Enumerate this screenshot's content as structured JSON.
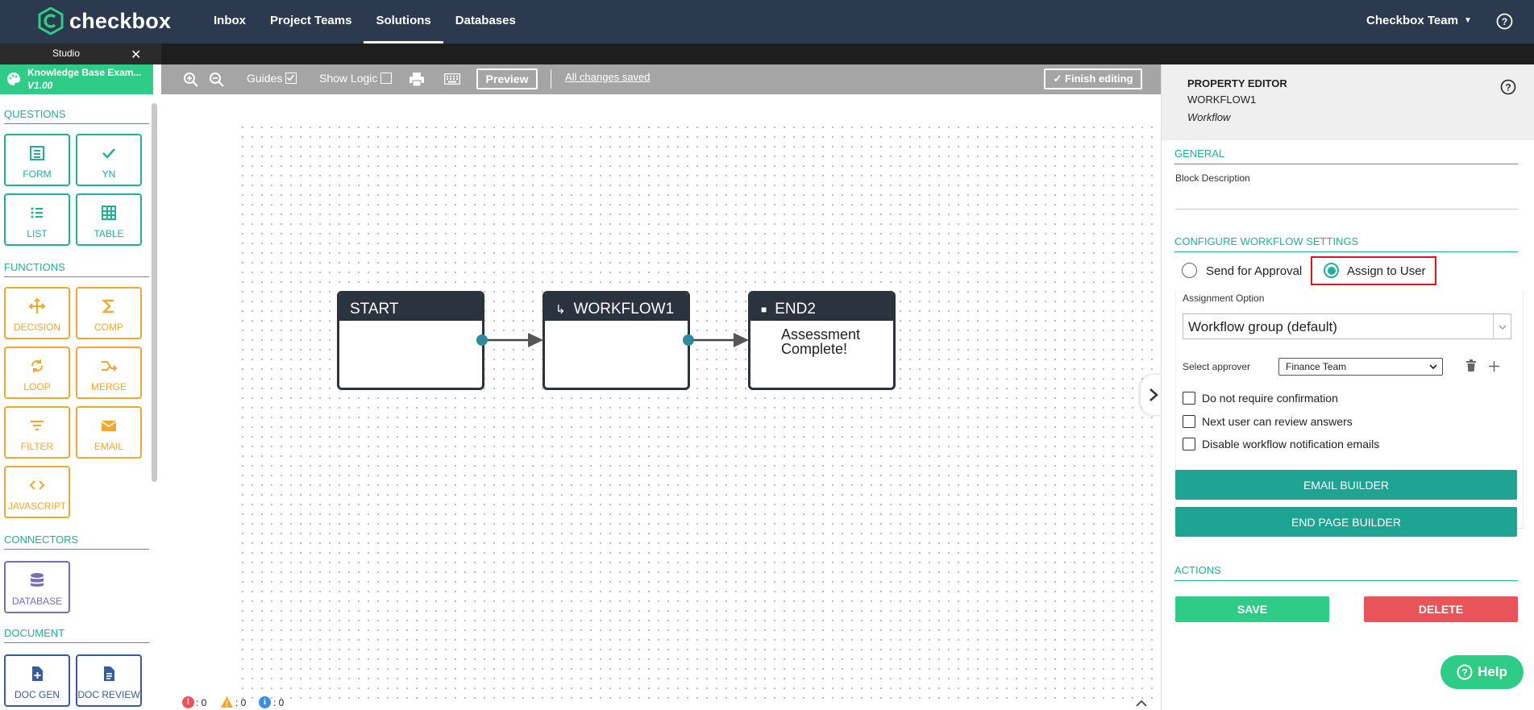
{
  "brand": {
    "name": "checkbox",
    "color": "#2ecc87"
  },
  "nav": {
    "links": [
      {
        "label": "Inbox",
        "active": false
      },
      {
        "label": "Project Teams",
        "active": false
      },
      {
        "label": "Solutions",
        "active": true
      },
      {
        "label": "Databases",
        "active": false
      }
    ],
    "team": "Checkbox Team"
  },
  "studio": {
    "tab_label": "Studio",
    "close": "✕"
  },
  "project": {
    "title": "Knowledge Base Exam...",
    "version": "V1.00"
  },
  "sidebar": {
    "questions": {
      "title": "QUESTIONS",
      "items": [
        "FORM",
        "YN",
        "LIST",
        "TABLE"
      ]
    },
    "functions": {
      "title": "FUNCTIONS",
      "items": [
        "DECISION",
        "COMP",
        "LOOP",
        "MERGE",
        "FILTER",
        "EMAIL",
        "JAVASCRIPT"
      ]
    },
    "connectors": {
      "title": "CONNECTORS",
      "items": [
        "DATABASE"
      ]
    },
    "document": {
      "title": "DOCUMENT",
      "items": [
        "DOC GEN",
        "DOC REVIEW"
      ]
    }
  },
  "toolbar": {
    "guides": "Guides",
    "guides_checked": true,
    "show_logic": "Show Logic",
    "show_logic_checked": false,
    "preview": "Preview",
    "status": "All changes saved",
    "finish": "Finish editing"
  },
  "canvas": {
    "nodes": [
      {
        "title": "START",
        "icon": "",
        "body": ""
      },
      {
        "title": "WORKFLOW1",
        "icon": "↳",
        "body": ""
      },
      {
        "title": "END2",
        "icon": "■",
        "body": "Assessment Complete!"
      }
    ]
  },
  "status_counts": {
    "errors": ": 0",
    "warnings": ": 0",
    "info": ": 0"
  },
  "property_editor": {
    "title": "PROPERTY EDITOR",
    "block_name": "WORKFLOW1",
    "block_type": "Workflow",
    "general": {
      "title": "GENERAL",
      "description_label": "Block Description"
    },
    "workflow": {
      "title": "CONFIGURE WORKFLOW SETTINGS",
      "options": [
        {
          "label": "Send for Approval",
          "selected": false
        },
        {
          "label": "Assign to User",
          "selected": true
        }
      ],
      "assignment_label": "Assignment Option",
      "assignment_value": "Workflow group (default)",
      "approver_label": "Select approver",
      "approver_value": "Finance Team",
      "checkboxes": [
        {
          "label": "Do not require confirmation",
          "checked": false
        },
        {
          "label": "Next user can review answers",
          "checked": false
        },
        {
          "label": "Disable workflow notification emails",
          "checked": false
        }
      ]
    },
    "email_builder": "EMAIL BUILDER",
    "end_page_builder": "END PAGE BUILDER",
    "actions": {
      "title": "ACTIONS",
      "save": "SAVE",
      "delete": "DELETE"
    }
  },
  "help": {
    "label": "Help"
  },
  "colors": {
    "accent": "#1fb09a",
    "nav": "#2b3a4f",
    "save": "#2ecc87",
    "delete": "#e8545a",
    "highlight": "#e0141e"
  }
}
